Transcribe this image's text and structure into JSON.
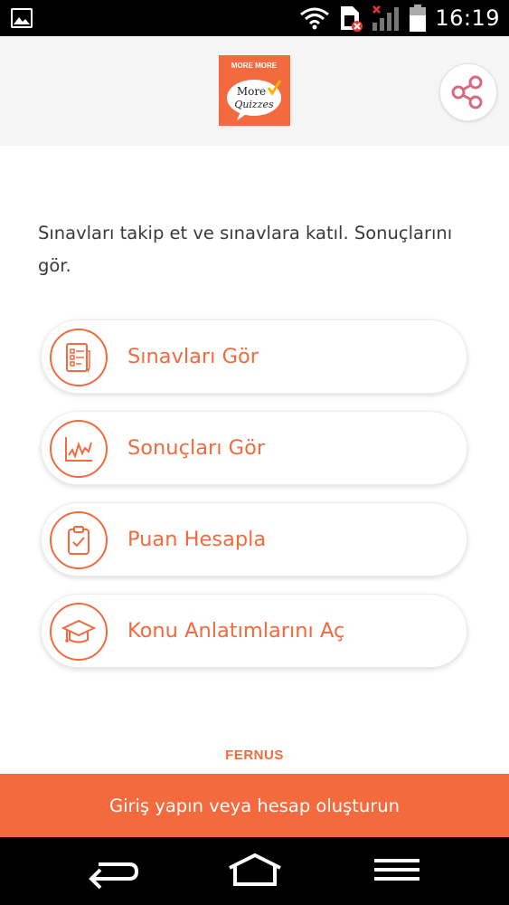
{
  "status_bar": {
    "time": "16:19",
    "icons": [
      "gallery-icon",
      "wifi-icon",
      "sim-error-icon",
      "signal-icon",
      "battery-icon"
    ]
  },
  "header": {
    "logo_top_text": "MORE MORE",
    "logo_main_text": "More",
    "logo_sub_text": "Quizzes",
    "share_icon": "share-icon"
  },
  "intro_text": "Sınavları takip et ve sınavlara katıl. Sonuçlarını gör.",
  "menu": [
    {
      "label": "Sınavları Gör",
      "icon": "exam-list-icon"
    },
    {
      "label": "Sonuçları Gör",
      "icon": "chart-icon"
    },
    {
      "label": "Puan Hesapla",
      "icon": "clipboard-check-icon"
    },
    {
      "label": "Konu Anlatımlarını Aç",
      "icon": "graduation-cap-icon"
    }
  ],
  "brand": "FERNUS",
  "login_bar": "Giriş yapın veya hesap oluşturun",
  "nav": [
    "back-icon",
    "home-icon",
    "menu-icon"
  ],
  "colors": {
    "accent": "#f26a3d",
    "status_bar": "#000000",
    "header_bg": "#f5f5f5",
    "share_icon": "#d9697f"
  }
}
